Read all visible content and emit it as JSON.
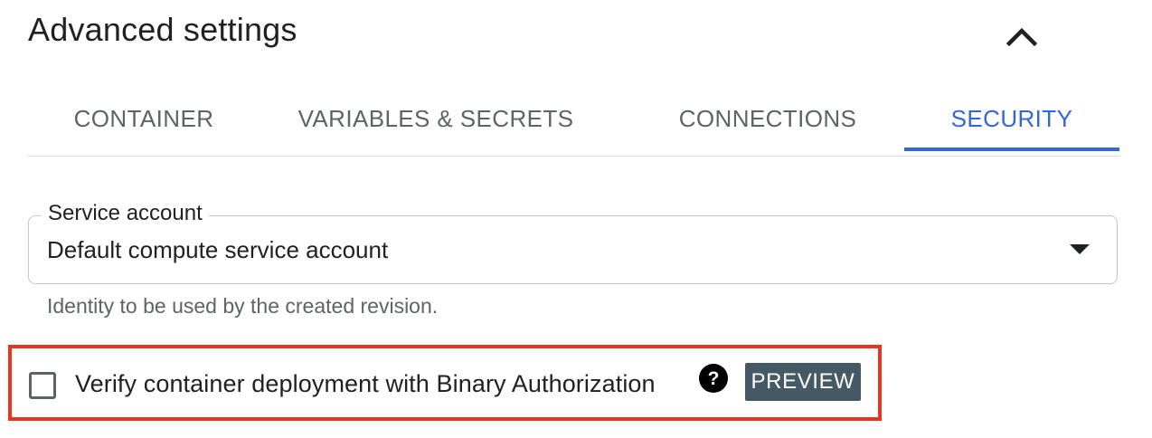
{
  "section": {
    "title": "Advanced settings",
    "collapse_icon": "chevron-up-icon"
  },
  "tabs": [
    {
      "label": "CONTAINER",
      "active": false
    },
    {
      "label": "VARIABLES & SECRETS",
      "active": false
    },
    {
      "label": "CONNECTIONS",
      "active": false
    },
    {
      "label": "SECURITY",
      "active": true
    }
  ],
  "service_account": {
    "label": "Service account",
    "value": "Default compute service account",
    "helper": "Identity to be used by the created revision.",
    "dropdown_icon": "arrow-drop-down-icon"
  },
  "binary_auth": {
    "label": "Verify container deployment with Binary Authorization",
    "checked": false,
    "help_icon": "help-icon",
    "badge": "PREVIEW"
  },
  "colors": {
    "accent": "#3367d6",
    "highlight": "#ea3323",
    "badge": "#455a64"
  }
}
